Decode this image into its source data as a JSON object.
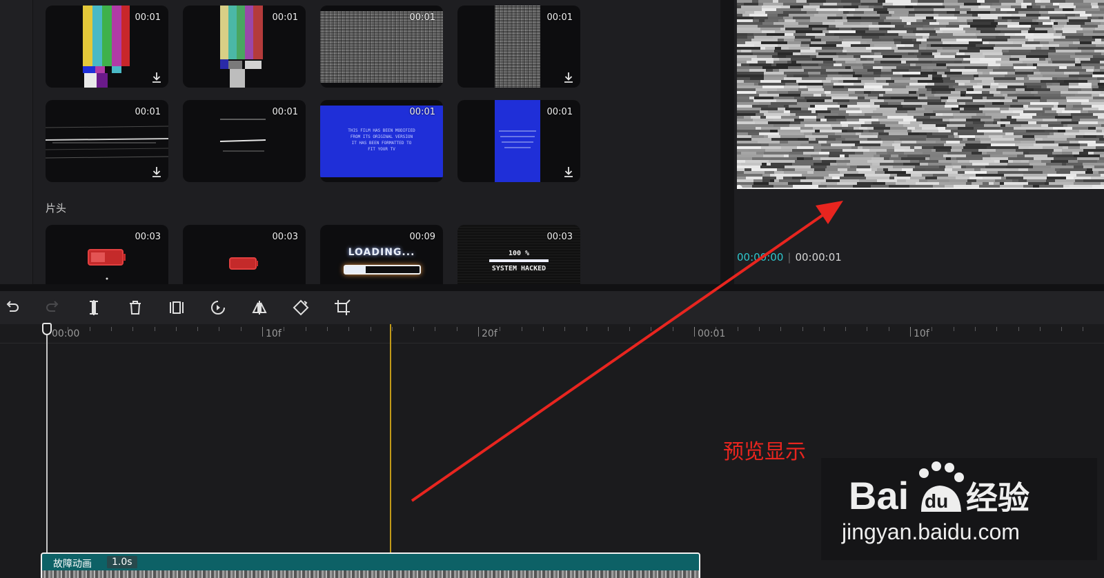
{
  "library": {
    "rows": [
      [
        {
          "duration": "00:01",
          "download": true,
          "kind": "color-bars"
        },
        {
          "duration": "00:01",
          "download": false,
          "kind": "color-bars-narrow"
        },
        {
          "duration": "00:01",
          "download": false,
          "kind": "static-noise"
        },
        {
          "duration": "00:01",
          "download": true,
          "kind": "static-noise-narrow"
        }
      ],
      [
        {
          "duration": "00:01",
          "download": true,
          "kind": "scanlines"
        },
        {
          "duration": "00:01",
          "download": false,
          "kind": "scanlines-narrow"
        },
        {
          "duration": "00:01",
          "download": false,
          "kind": "blue-screen"
        },
        {
          "duration": "00:01",
          "download": true,
          "kind": "blue-screen-narrow"
        }
      ]
    ],
    "section_title": "片头",
    "intro_row": [
      {
        "duration": "00:03",
        "kind": "battery"
      },
      {
        "duration": "00:03",
        "kind": "battery-small"
      },
      {
        "duration": "00:09",
        "kind": "loading"
      },
      {
        "duration": "00:03",
        "kind": "system-hacked"
      }
    ],
    "blue_screen_text": [
      "THIS FILM HAS BEEN MODIFIED",
      "FROM ITS ORIGINAL VERSION",
      "IT HAS BEEN FORMATTED TO",
      "FIT YOUR TV"
    ],
    "loading_text": "LOADING...",
    "hacked_percent": "100 %",
    "hacked_text": "SYSTEM HACKED"
  },
  "preview": {
    "time_current": "00:00:00",
    "time_total": "00:00:01"
  },
  "toolbar": {
    "tools": [
      "undo-icon",
      "redo-icon",
      "split-icon",
      "delete-icon",
      "freeze-icon",
      "reverse-icon",
      "mirror-icon",
      "rotate-icon",
      "crop-icon"
    ]
  },
  "timeline": {
    "ruler_labels": [
      "00:00",
      "10f",
      "20f",
      "00:01",
      "10f"
    ],
    "clip": {
      "name": "故障动画",
      "duration": "1.0s"
    }
  },
  "annotation": {
    "text": "预览显示",
    "color": "#e8251f"
  },
  "watermark": {
    "brand": "Bai",
    "brand_du": "du",
    "product": "经验",
    "url": "jingyan.baidu.com"
  },
  "colors": {
    "accent_cyan": "#2ec6cc",
    "clip_teal": "#0d6166",
    "marker_gold": "#c19a18",
    "blue_screen": "#1f2fd8"
  }
}
